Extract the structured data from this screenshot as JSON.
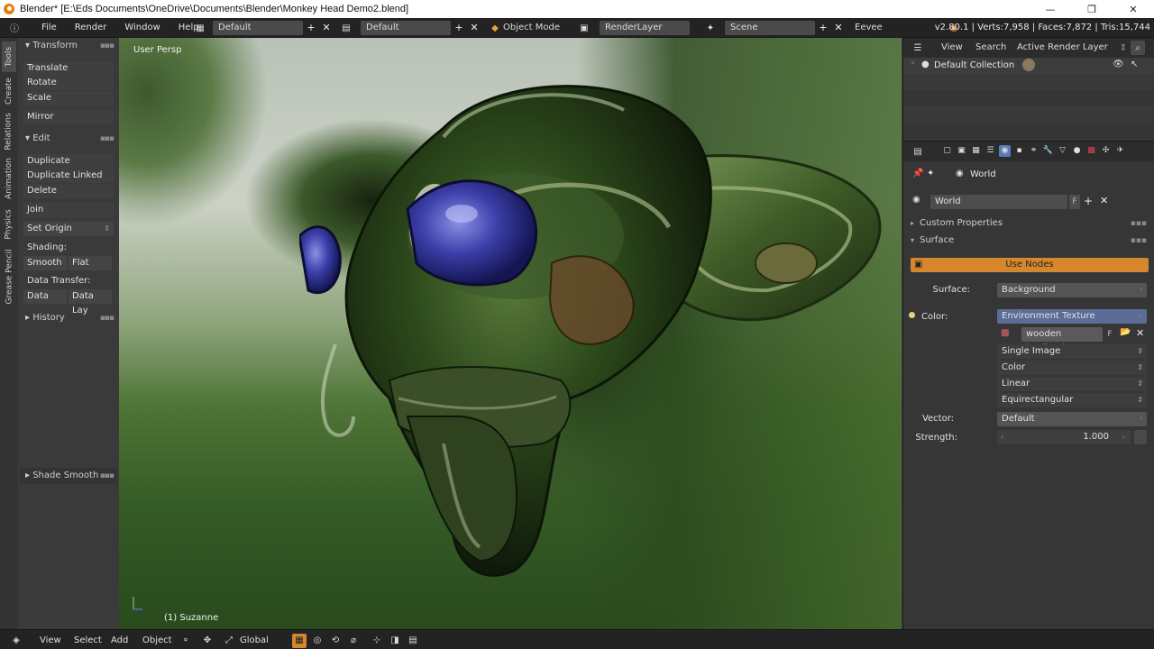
{
  "window": {
    "title": "Blender* [E:\\Eds Documents\\OneDrive\\Documents\\Blender\\Monkey Head Demo2.blend]",
    "minimize": "—",
    "maximize": "❐",
    "close": "✕"
  },
  "topbar": {
    "menus": [
      "File",
      "Render",
      "Window",
      "Help"
    ],
    "screen_layout": "Default",
    "workspace": "Default",
    "mode": "Object Mode",
    "render_layer": "RenderLayer",
    "scene": "Scene",
    "engine": "Eevee",
    "stats": "v2.80.1 | Verts:7,958 | Faces:7,872 | Tris:15,744"
  },
  "tabs": [
    "Tools",
    "Create",
    "Relations",
    "Animation",
    "Physics",
    "Grease Pencil"
  ],
  "toolshelf": {
    "transform_header": "Transform",
    "translate": "Translate",
    "rotate": "Rotate",
    "scale": "Scale",
    "mirror": "Mirror",
    "edit_header": "Edit",
    "duplicate": "Duplicate",
    "duplicate_linked": "Duplicate Linked",
    "delete": "Delete",
    "join": "Join",
    "set_origin": "Set Origin",
    "shading_label": "Shading:",
    "smooth": "Smooth",
    "flat": "Flat",
    "data_transfer_label": "Data Transfer:",
    "data": "Data",
    "data_lay": "Data Lay",
    "history_header": "History",
    "shade_smooth_header": "Shade Smooth"
  },
  "viewport": {
    "view_label": "User Persp",
    "object_label": "(1) Suzanne"
  },
  "bottombar": {
    "view": "View",
    "select": "Select",
    "add": "Add",
    "object": "Object",
    "orientation": "Global"
  },
  "outliner": {
    "view": "View",
    "search": "Search",
    "display_mode": "Active Render Layer",
    "collection": "Default Collection"
  },
  "properties": {
    "context": "World",
    "world_name": "World",
    "world_fake": "F",
    "custom_properties": "Custom Properties",
    "surface_section": "Surface",
    "use_nodes": "Use Nodes",
    "surface_label": "Surface:",
    "surface_value": "Background",
    "color_label": "Color:",
    "color_value": "Environment Texture",
    "image_name": "wooden landing.jpg",
    "image_fake": "F",
    "source": "Single Image",
    "color_space": "Color",
    "interpolation": "Linear",
    "projection": "Equirectangular",
    "vector_label": "Vector:",
    "vector_value": "Default",
    "strength_label": "Strength:",
    "strength_value": "1.000"
  },
  "colors": {
    "accent_orange": "#d6872e",
    "env_blue": "#5b6d96",
    "header": "#232323",
    "panel": "#363636"
  }
}
